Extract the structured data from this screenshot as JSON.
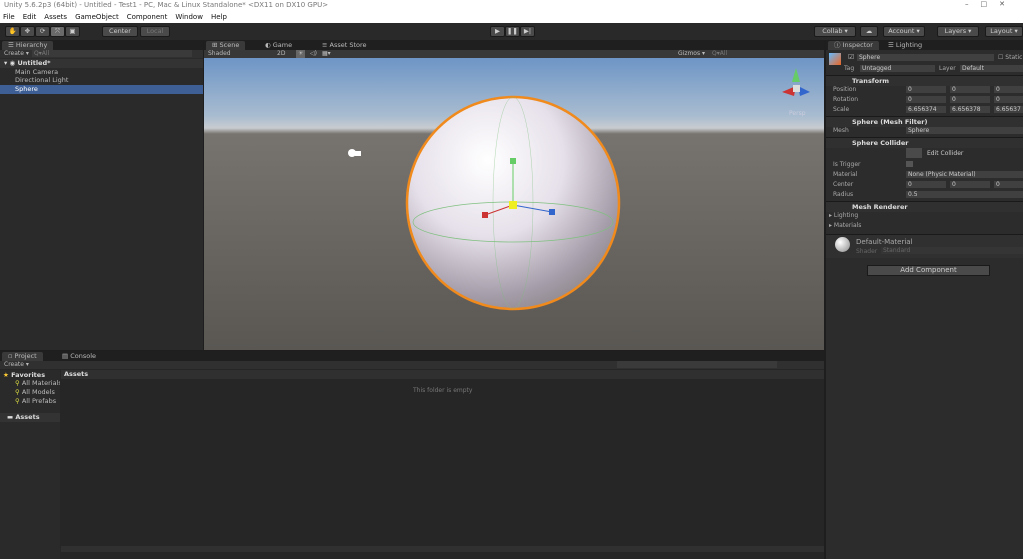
{
  "window": {
    "title": "Unity 5.6.2p3 (64bit) - Untitled - Test1 - PC, Mac & Linux Standalone* <DX11 on DX10 GPU>",
    "controls": "–□✕"
  },
  "menu": [
    "File",
    "Edit",
    "Assets",
    "GameObject",
    "Component",
    "Window",
    "Help"
  ],
  "toolbar": {
    "center": "Center",
    "local": "Local",
    "collab": "Collab ▾",
    "account": "Account ▾",
    "layers": "Layers ▾",
    "layout": "Layout ▾"
  },
  "hierarchy": {
    "tab": "Hierarchy",
    "create": "Create ▾",
    "search": "Q▾All",
    "scene": "Untitled*",
    "items": [
      "Main Camera",
      "Directional Light",
      "Sphere"
    ]
  },
  "scene": {
    "tabs": [
      "Scene",
      "Game",
      "Asset Store"
    ],
    "shaded": "Shaded",
    "mode2d": "2D",
    "gizmos": "Gizmos ▾",
    "q_all": "Q▾All",
    "persp": "Persp"
  },
  "project": {
    "tabs": [
      "Project",
      "Console"
    ],
    "create": "Create ▾",
    "favorites": "Favorites",
    "fav_items": [
      "All Materials",
      "All Models",
      "All Prefabs"
    ],
    "assets": "Assets",
    "assets_header": "Assets",
    "empty": "This folder is empty"
  },
  "inspector": {
    "tabs": [
      "Inspector",
      "Lighting"
    ],
    "name": "Sphere",
    "static": "Static",
    "tag_label": "Tag",
    "tag": "Untagged",
    "layer_label": "Layer",
    "layer": "Default",
    "transform": {
      "title": "Transform",
      "rows": [
        {
          "label": "Position",
          "x": "0",
          "y": "0",
          "z": "0"
        },
        {
          "label": "Rotation",
          "x": "0",
          "y": "0",
          "z": "0"
        },
        {
          "label": "Scale",
          "x": "6.656374",
          "y": "6.656378",
          "z": "6.65637"
        }
      ]
    },
    "mesh_filter": {
      "title": "Sphere (Mesh Filter)",
      "mesh_label": "Mesh",
      "mesh": "Sphere"
    },
    "collider": {
      "title": "Sphere Collider",
      "edit": "Edit Collider",
      "trigger": "Is Trigger",
      "material_label": "Material",
      "material": "None (Physic Material)",
      "center_label": "Center",
      "cx": "0",
      "cy": "0",
      "cz": "0",
      "radius_label": "Radius",
      "radius": "0.5"
    },
    "renderer": {
      "title": "Mesh Renderer",
      "lighting": "Lighting",
      "materials": "Materials"
    },
    "material": {
      "name": "Default-Material",
      "shader_label": "Shader",
      "shader": "Standard"
    },
    "add_component": "Add Component"
  }
}
